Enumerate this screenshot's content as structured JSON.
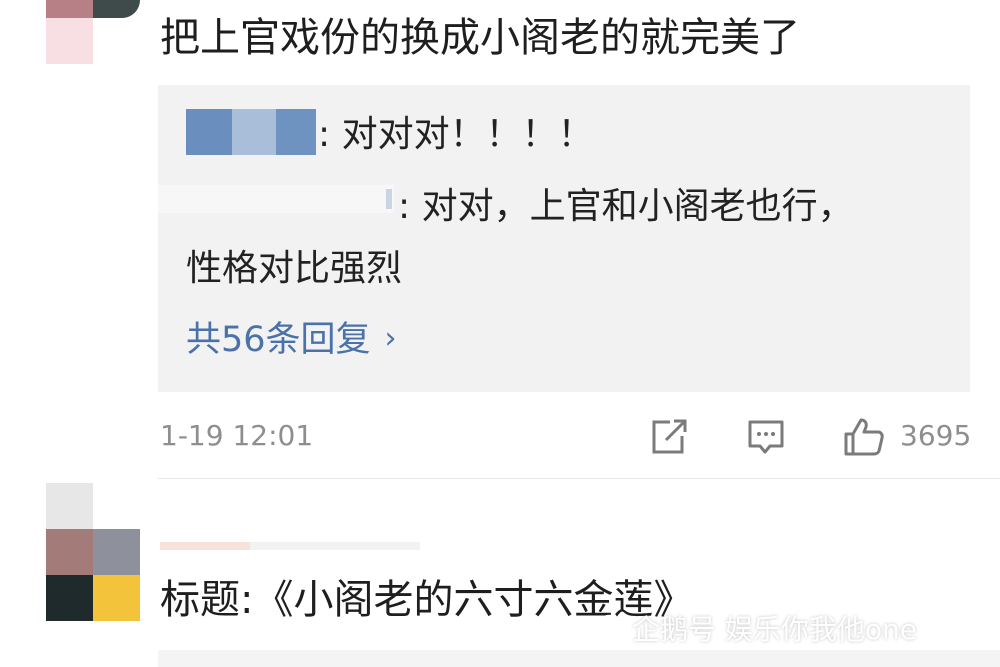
{
  "comment": {
    "text": "把上官戏份的换成小阁老的就完美了",
    "time": "1-19 12:01",
    "like_count": "3695"
  },
  "replies": {
    "reply1_text": ": 对对对！！！！",
    "reply2_text_line1": ": 对对，上官和小阁老也行，",
    "reply2_text_line2": "性格对比强烈",
    "more_label": "共56条回复",
    "more_chevron": "›"
  },
  "next_comment": {
    "text": "标题:《小阁老的六寸六金莲》"
  },
  "watermark": {
    "text": "企鹅号 娱乐你我他one"
  },
  "icons": {
    "share": "share-icon",
    "comment": "comment-icon",
    "like": "thumbs-up-icon"
  },
  "colors": {
    "link": "#4a72a8",
    "meta": "#8e8e8e",
    "reply_bg": "#f2f2f2"
  }
}
